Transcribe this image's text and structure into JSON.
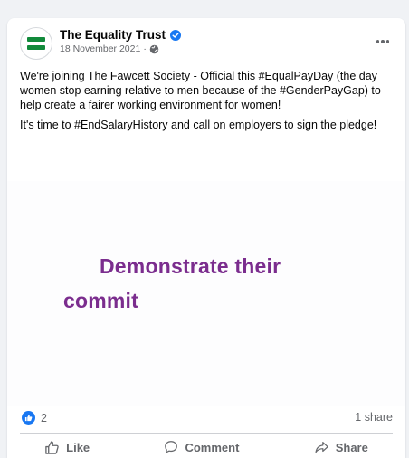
{
  "post": {
    "page_name": "The Equality Trust",
    "date": "18 November 2021",
    "separator": "·",
    "text_paragraphs": [
      "We're joining The Fawcett Society - Official this  #EqualPayDay (the day women stop earning relative to men because of the #GenderPayGap) to help create a  fairer working environment for women!",
      "It's time to #EndSalaryHistory and call on employers to sign the pledge!"
    ],
    "media": {
      "line1": "Demonstrate their",
      "line2": "commit"
    },
    "reactions_count": "2",
    "shares": "1 share",
    "actions": {
      "like": "Like",
      "comment": "Comment",
      "share": "Share"
    }
  },
  "icons": {
    "avatar": "equality-trust-logo",
    "verified": "verified-badge-icon",
    "privacy": "globe-icon",
    "more": "more-options-icon",
    "reaction": "like-reaction-icon"
  },
  "colors": {
    "accent": "#1877f2",
    "logo_green": "#128a3b",
    "media_text": "#7b2d8e",
    "secondary_text": "#65676b"
  }
}
